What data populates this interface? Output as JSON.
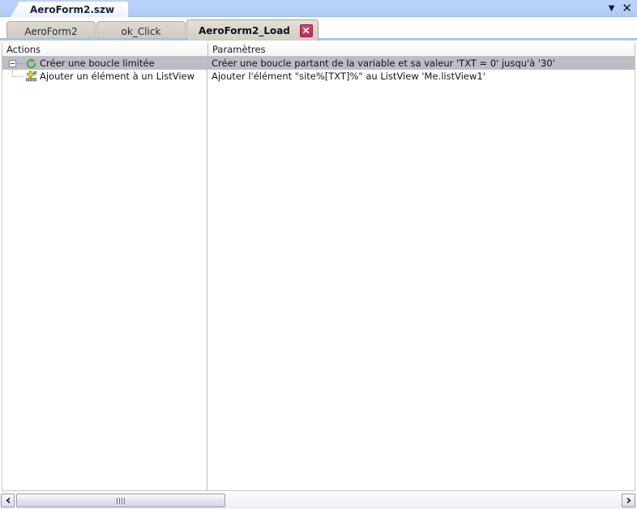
{
  "window": {
    "document_tab_title": "AeroForm2.szw",
    "caret_icon": "chevron-down-icon",
    "close_icon": "close-icon"
  },
  "tabs": [
    {
      "label": "AeroForm2",
      "active": false,
      "closable": false
    },
    {
      "label": "ok_Click",
      "active": false,
      "closable": false
    },
    {
      "label": "AeroForm2_Load",
      "active": true,
      "closable": true
    }
  ],
  "columns": {
    "actions": "Actions",
    "parameters": "Paramètres"
  },
  "rows": [
    {
      "level": 0,
      "expanded": true,
      "selected": true,
      "icon": "loop-arrow-icon",
      "action": "Créer une boucle limitée",
      "parameters": "Créer une boucle partant de la variable et sa valeur 'TXT = 0' jusqu'à '30'"
    },
    {
      "level": 1,
      "expanded": false,
      "selected": false,
      "icon": "add-listview-item-icon",
      "action": "Ajouter un élément à un ListView",
      "parameters": "Ajouter l'élément \"site%[TXT]%\" au ListView 'Me.listView1'"
    }
  ],
  "scrollbar": {
    "left_arrow_icon": "arrow-left-icon",
    "right_arrow_icon": "arrow-right-icon",
    "thumb_grip_icon": "grip-icon"
  },
  "colors": {
    "titlebar": "#b6d1f6",
    "tab_active": "#dcd8cf",
    "tab_inactive": "#d6d2c8",
    "selection": "#bcbdc6",
    "close_button": "#c32b5c",
    "loop_icon": "#4caf50",
    "add_icon": "#f5d020"
  }
}
